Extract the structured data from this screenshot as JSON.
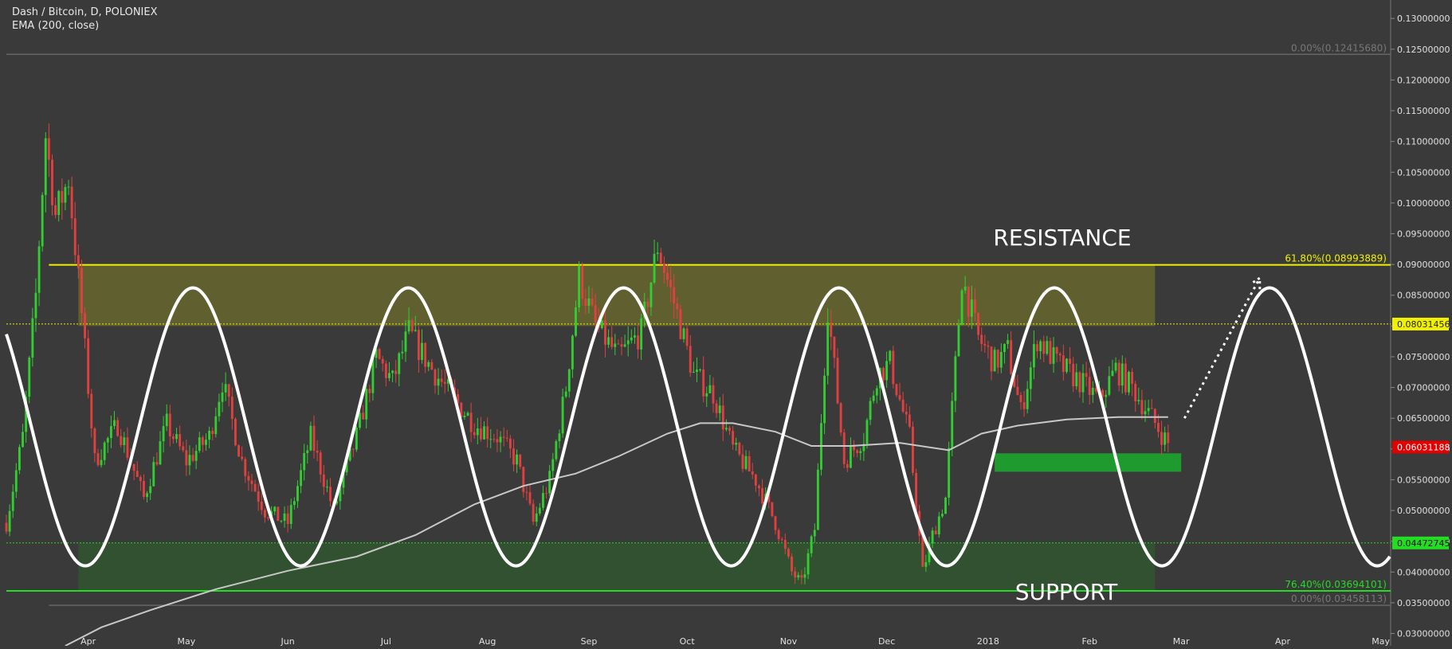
{
  "header": {
    "title": "Dash / Bitcoin, D, POLONIEX",
    "indicator": "EMA (200, close)"
  },
  "colors": {
    "background": "#3a3a3a",
    "up": "#33cc33",
    "down": "#e04040",
    "resistance": "#f0f000",
    "support": "#22dd22",
    "ema": "#c8c8c8"
  },
  "chart_data": {
    "type": "candlestick",
    "ylim": [
      0.028,
      0.133
    ],
    "y_ticks": [
      "0.03000000",
      "0.03500000",
      "0.04000000",
      "0.04500000",
      "0.05000000",
      "0.05500000",
      "0.06000000",
      "0.06500000",
      "0.07000000",
      "0.07500000",
      "0.08000000",
      "0.08500000",
      "0.09000000",
      "0.09500000",
      "0.10000000",
      "0.10500000",
      "0.11000000",
      "0.11500000",
      "0.12000000",
      "0.12500000",
      "0.13000000"
    ],
    "y_tick_values": [
      0.03,
      0.035,
      0.04,
      0.045,
      0.05,
      0.055,
      0.06,
      0.065,
      0.07,
      0.075,
      0.08,
      0.085,
      0.09,
      0.095,
      0.1,
      0.105,
      0.11,
      0.115,
      0.12,
      0.125,
      0.13
    ],
    "x_ticks": [
      {
        "label": "Apr",
        "date": "2017-04-01"
      },
      {
        "label": "May",
        "date": "2017-05-01"
      },
      {
        "label": "Jun",
        "date": "2017-06-01"
      },
      {
        "label": "Jul",
        "date": "2017-07-01"
      },
      {
        "label": "Aug",
        "date": "2017-08-01"
      },
      {
        "label": "Sep",
        "date": "2017-09-01"
      },
      {
        "label": "Oct",
        "date": "2017-10-01"
      },
      {
        "label": "Nov",
        "date": "2017-11-01"
      },
      {
        "label": "Dec",
        "date": "2017-12-01"
      },
      {
        "label": "2018",
        "date": "2018-01-01"
      },
      {
        "label": "Feb",
        "date": "2018-02-01"
      },
      {
        "label": "Mar",
        "date": "2018-03-01"
      },
      {
        "label": "Apr",
        "date": "2018-04-01"
      },
      {
        "label": "May",
        "date": "2018-05-01"
      }
    ],
    "x_range": [
      "2017-03-07",
      "2018-05-04"
    ],
    "price_path": [
      [
        "2017-03-07",
        0.048
      ],
      [
        "2017-03-12",
        0.062
      ],
      [
        "2017-03-16",
        0.085
      ],
      [
        "2017-03-19",
        0.111
      ],
      [
        "2017-03-22",
        0.098
      ],
      [
        "2017-03-26",
        0.104
      ],
      [
        "2017-03-30",
        0.082
      ],
      [
        "2017-04-03",
        0.058
      ],
      [
        "2017-04-10",
        0.064
      ],
      [
        "2017-04-18",
        0.052
      ],
      [
        "2017-04-25",
        0.064
      ],
      [
        "2017-05-01",
        0.058
      ],
      [
        "2017-05-08",
        0.062
      ],
      [
        "2017-05-12",
        0.071
      ],
      [
        "2017-05-18",
        0.058
      ],
      [
        "2017-05-25",
        0.05
      ],
      [
        "2017-06-01",
        0.048
      ],
      [
        "2017-06-08",
        0.062
      ],
      [
        "2017-06-15",
        0.05
      ],
      [
        "2017-06-22",
        0.062
      ],
      [
        "2017-06-28",
        0.075
      ],
      [
        "2017-07-03",
        0.071
      ],
      [
        "2017-07-08",
        0.079
      ],
      [
        "2017-07-15",
        0.073
      ],
      [
        "2017-07-22",
        0.068
      ],
      [
        "2017-07-28",
        0.064
      ],
      [
        "2017-08-04",
        0.062
      ],
      [
        "2017-08-10",
        0.058
      ],
      [
        "2017-08-15",
        0.048
      ],
      [
        "2017-08-20",
        0.055
      ],
      [
        "2017-08-25",
        0.07
      ],
      [
        "2017-08-29",
        0.088
      ],
      [
        "2017-09-03",
        0.08
      ],
      [
        "2017-09-10",
        0.075
      ],
      [
        "2017-09-17",
        0.079
      ],
      [
        "2017-09-22",
        0.093
      ],
      [
        "2017-09-28",
        0.082
      ],
      [
        "2017-10-03",
        0.072
      ],
      [
        "2017-10-09",
        0.069
      ],
      [
        "2017-10-15",
        0.06
      ],
      [
        "2017-10-22",
        0.055
      ],
      [
        "2017-10-28",
        0.048
      ],
      [
        "2017-11-02",
        0.04
      ],
      [
        "2017-11-05",
        0.038
      ],
      [
        "2017-11-09",
        0.047
      ],
      [
        "2017-11-13",
        0.083
      ],
      [
        "2017-11-18",
        0.058
      ],
      [
        "2017-11-24",
        0.062
      ],
      [
        "2017-11-28",
        0.072
      ],
      [
        "2017-12-02",
        0.074
      ],
      [
        "2017-12-08",
        0.062
      ],
      [
        "2017-12-12",
        0.04
      ],
      [
        "2017-12-15",
        0.046
      ],
      [
        "2017-12-19",
        0.052
      ],
      [
        "2017-12-24",
        0.088
      ],
      [
        "2017-12-29",
        0.078
      ],
      [
        "2018-01-03",
        0.074
      ],
      [
        "2018-01-07",
        0.076
      ],
      [
        "2018-01-11",
        0.066
      ],
      [
        "2018-01-16",
        0.078
      ],
      [
        "2018-01-22",
        0.074
      ],
      [
        "2018-01-29",
        0.071
      ],
      [
        "2018-02-04",
        0.068
      ],
      [
        "2018-02-09",
        0.073
      ],
      [
        "2018-02-14",
        0.07
      ],
      [
        "2018-02-20",
        0.065
      ],
      [
        "2018-02-26",
        0.06
      ]
    ],
    "ema": [
      [
        "2017-03-25",
        0.028
      ],
      [
        "2017-04-05",
        0.031
      ],
      [
        "2017-04-20",
        0.0338
      ],
      [
        "2017-05-10",
        0.0372
      ],
      [
        "2017-06-01",
        0.0402
      ],
      [
        "2017-06-22",
        0.0425
      ],
      [
        "2017-07-10",
        0.046
      ],
      [
        "2017-07-28",
        0.051
      ],
      [
        "2017-08-12",
        0.054
      ],
      [
        "2017-08-28",
        0.056
      ],
      [
        "2017-09-10",
        0.0588
      ],
      [
        "2017-09-25",
        0.0625
      ],
      [
        "2017-10-05",
        0.0642
      ],
      [
        "2017-10-15",
        0.0642
      ],
      [
        "2017-10-28",
        0.0628
      ],
      [
        "2017-11-08",
        0.0605
      ],
      [
        "2017-11-20",
        0.0605
      ],
      [
        "2017-12-05",
        0.061
      ],
      [
        "2017-12-20",
        0.0598
      ],
      [
        "2017-12-30",
        0.0625
      ],
      [
        "2018-01-10",
        0.0638
      ],
      [
        "2018-01-25",
        0.0648
      ],
      [
        "2018-02-10",
        0.0652
      ],
      [
        "2018-02-25",
        0.0652
      ]
    ],
    "levels": [
      {
        "name": "fib-0-top",
        "label": "0.00%(0.12415680)",
        "value": 0.1241568
      },
      {
        "name": "fib-61.8",
        "label": "61.80%(0.08993889)",
        "value": 0.08993889
      },
      {
        "name": "dotted-yellow",
        "label": "0.08031456",
        "value": 0.08031456
      },
      {
        "name": "current-price",
        "label": "0.06031188",
        "value": 0.06031188
      },
      {
        "name": "dotted-green",
        "label": "0.04472745",
        "value": 0.04472745
      },
      {
        "name": "fib-76.4",
        "label": "76.40%(0.03694101)",
        "value": 0.03694101
      },
      {
        "name": "fib-0-bottom",
        "label": "0.00%(0.03458113)",
        "value": 0.03458113
      }
    ],
    "zones": [
      {
        "name": "resistance-zone",
        "from": 0.08,
        "to": 0.0899,
        "start": "2017-03-29",
        "end": "2018-02-21"
      },
      {
        "name": "support-zone",
        "from": 0.0369,
        "to": 0.0447,
        "start": "2017-03-29",
        "end": "2018-02-21"
      },
      {
        "name": "target-box",
        "from": 0.0563,
        "to": 0.0593,
        "start": "2018-01-03",
        "end": "2018-03-01"
      }
    ],
    "wave": {
      "min": 0.041,
      "max": 0.0862,
      "peaks": [
        "2017-05-03",
        "2017-07-07",
        "2017-09-13",
        "2017-11-17",
        "2018-01-23",
        "2018-03-28"
      ],
      "start": "2017-03-07",
      "end": "2018-05-04"
    },
    "projection": {
      "from": [
        "2018-03-02",
        0.065
      ],
      "to": [
        "2018-03-25",
        0.0878
      ]
    },
    "annotations": [
      "RESISTANCE",
      "SUPPORT"
    ]
  }
}
